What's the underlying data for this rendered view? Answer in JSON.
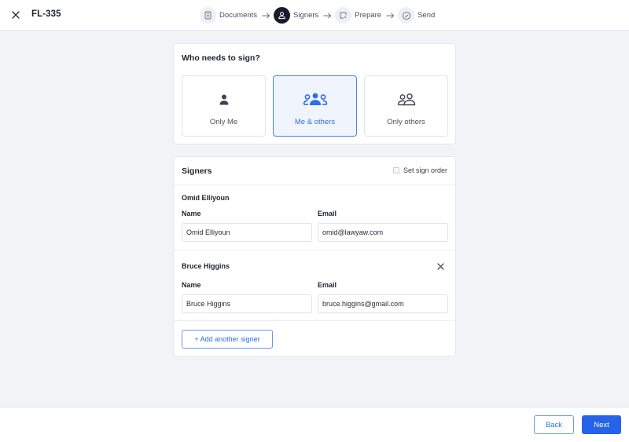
{
  "header": {
    "close_icon": "close-icon",
    "title": "FL-335",
    "steps": [
      {
        "label": "Documents",
        "icon": "document-icon",
        "active": false
      },
      {
        "label": "Signers",
        "icon": "user-icon",
        "active": true
      },
      {
        "label": "Prepare",
        "icon": "prepare-cursor-icon",
        "active": false
      },
      {
        "label": "Send",
        "icon": "check-circle-icon",
        "active": false
      }
    ]
  },
  "who": {
    "title": "Who needs to sign?",
    "options": [
      {
        "label": "Only Me",
        "icon": "single-user-icon",
        "selected": false
      },
      {
        "label": "Me & others",
        "icon": "group-users-icon",
        "selected": true
      },
      {
        "label": "Only others",
        "icon": "two-users-outline-icon",
        "selected": false
      }
    ]
  },
  "signers": {
    "title": "Signers",
    "sign_order_label": "Set sign order",
    "sign_order_checked": false,
    "list": [
      {
        "heading": "Omid Elliyoun",
        "name_label": "Name",
        "email_label": "Email",
        "name": "Omid Elliyoun",
        "email": "omid@lawyaw.com",
        "removable": false
      },
      {
        "heading": "Bruce Higgins",
        "name_label": "Name",
        "email_label": "Email",
        "name": "Bruce Higgins",
        "email": "bruce.higgins@gmail.com",
        "removable": true
      }
    ],
    "add_label": "+ Add another signer"
  },
  "footer": {
    "back_label": "Back",
    "next_label": "Next"
  },
  "colors": {
    "accent": "#2563eb",
    "selected_bg": "#eff4fd",
    "active_step": "#171b2c",
    "page_bg": "#f2f3f7"
  }
}
